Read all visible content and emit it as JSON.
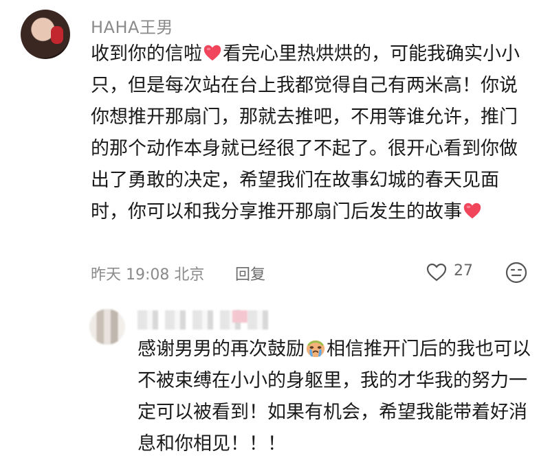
{
  "comment": {
    "author": "HAHA王男",
    "text_part1": "收到你的信啦",
    "text_part2": "看完心里热烘烘的，可能我确实小小只，但是每次站在台上我都觉得自己有两米高！你说你想推开那扇门，那就去推吧，不用等谁允许，推门的那个动作本身就已经很了不起了。很开心看到你做出了勇敢的决定，希望我们在故事幻城的春天见面时，你可以和我分享推开那扇门后发生的故事",
    "time_location": "昨天 19:08 北京",
    "reply_label": "回复",
    "like_count": "27",
    "icons": {
      "heart": "heart-emoji",
      "like": "heart-outline-icon",
      "emoji": "emoji-icon"
    },
    "colors": {
      "heart": "#f0455b",
      "meta_gray": "#8a8a8a"
    }
  },
  "reply": {
    "text_part1": "感谢男男的再次鼓励",
    "text_part2": "相信推开门后的我也可以不被束缚在小小的身躯里，我的才华我的努力一定可以被看到！如果有机会，希望我能带着好消息和你相见！！！",
    "icons": {
      "emoji": "crying-face-emoji"
    }
  }
}
